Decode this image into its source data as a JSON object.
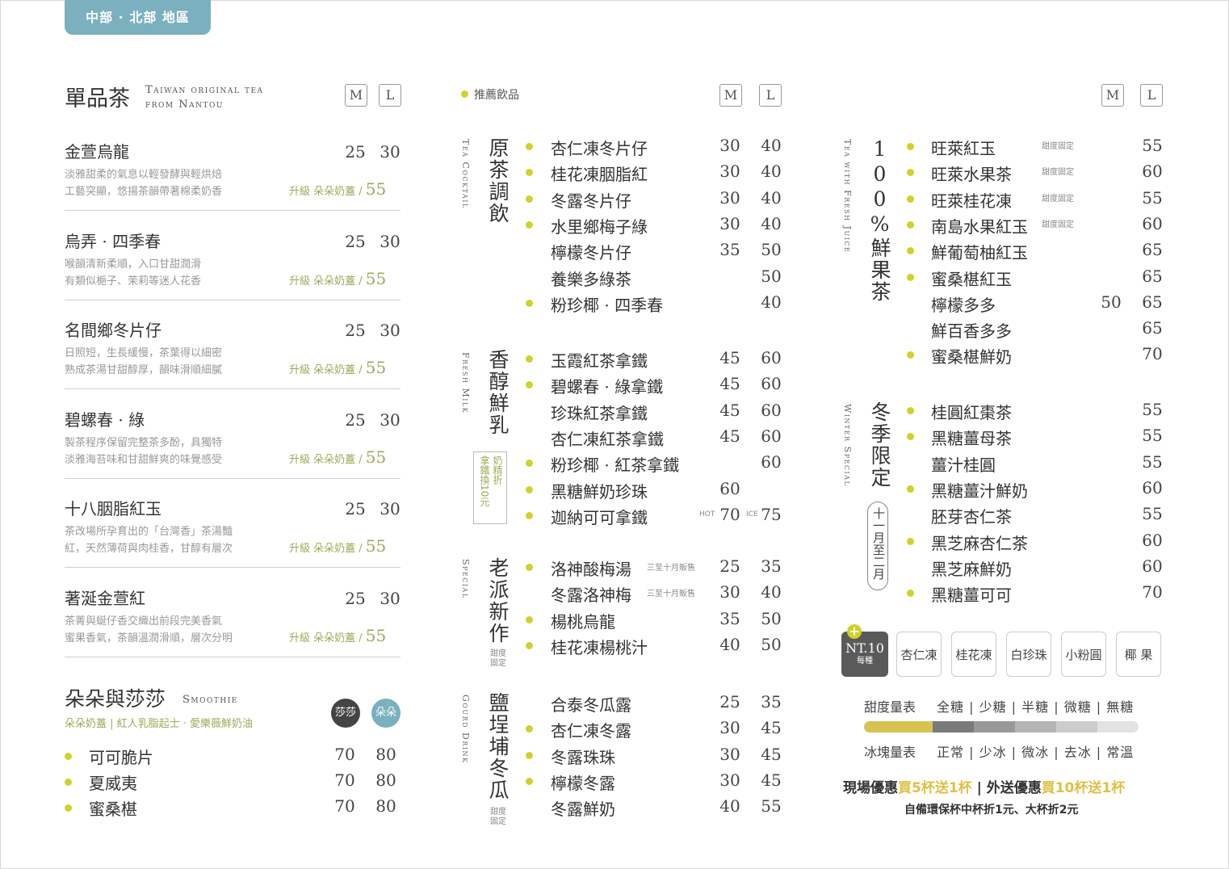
{
  "region": "中部 · 北部 地區",
  "size_m": "M",
  "size_l": "L",
  "single_tea": {
    "title": "單品茶",
    "en1": "Taiwan original tea",
    "en2": "from Nantou",
    "upgrade_label": "升級 朵朵奶蓋 / ",
    "upgrade_price": "55",
    "items": [
      {
        "name": "金萱烏龍",
        "m": "25",
        "l": "30",
        "d1": "淡雅甜柔的氣息以輕發酵與輕烘焙",
        "d2": "工藝突顯，悠揚茶韻帶著棉柔奶香"
      },
      {
        "name": "烏弄 · 四季春",
        "m": "25",
        "l": "30",
        "d1": "喉韻清新柔順，入口甘甜潤滑",
        "d2": "有類似梔子、茉莉等迷人花香"
      },
      {
        "name": "名間鄉冬片仔",
        "m": "25",
        "l": "30",
        "d1": "日照短，生長緩慢，茶葉得以細密",
        "d2": "熟成茶湯甘甜醇厚，韻味滑順細膩"
      },
      {
        "name": "碧螺春 · 綠",
        "m": "25",
        "l": "30",
        "d1": "製茶程序保留完整茶多酚，具獨特",
        "d2": "淡雅海苔味和甘甜鮮爽的味覺感受"
      },
      {
        "name": "十八胭脂紅玉",
        "m": "25",
        "l": "30",
        "d1": "茶改場所孕育出的「台灣香」茶湯豔",
        "d2": "紅，天然薄荷與肉桂香，甘醇有層次"
      },
      {
        "name": "著涎金萱紅",
        "m": "25",
        "l": "30",
        "d1": "茶菁與蜒仔香交織出前段完美香氣",
        "d2": "蜜果香氣，茶韻溫潤滑順，層次分明"
      }
    ]
  },
  "smoothie": {
    "title": "朵朵與莎莎",
    "en": "Smoothie",
    "sub": "朵朵奶蓋 | 紅人乳脂起士 · 愛樂薇鮮奶油",
    "circle1": "莎莎",
    "circle2": "朵朵",
    "items": [
      {
        "name": "可可脆片",
        "m": "70",
        "l": "80"
      },
      {
        "name": "夏威夷",
        "m": "70",
        "l": "80"
      },
      {
        "name": "蜜桑椹",
        "m": "70",
        "l": "80"
      }
    ]
  },
  "recommended": "推薦飲品",
  "tea_cocktail": {
    "title": "原茶調飲",
    "en": "Tea Cocktail",
    "items": [
      {
        "name": "杏仁凍冬片仔",
        "m": "30",
        "l": "40",
        "dot": true
      },
      {
        "name": "桂花凍胭脂紅",
        "m": "30",
        "l": "40",
        "dot": true
      },
      {
        "name": "冬露冬片仔",
        "m": "30",
        "l": "40",
        "dot": true
      },
      {
        "name": "水里鄉梅子綠",
        "m": "30",
        "l": "40",
        "dot": true
      },
      {
        "name": "檸檬冬片仔",
        "m": "35",
        "l": "50",
        "dot": false
      },
      {
        "name": "養樂多綠茶",
        "m": "",
        "l": "50",
        "dot": false
      },
      {
        "name": "粉珍椰 · 四季春",
        "m": "",
        "l": "40",
        "dot": true
      }
    ]
  },
  "fresh_milk": {
    "title": "香醇鮮乳",
    "en": "Fresh Milk",
    "swap_col1": "奶精折",
    "swap_col2": "拿鐵換10元",
    "hot": "HOT",
    "ice": "ICE",
    "items": [
      {
        "name": "玉霞紅茶拿鐵",
        "m": "45",
        "l": "60",
        "dot": true
      },
      {
        "name": "碧螺春 · 綠拿鐵",
        "m": "45",
        "l": "60",
        "dot": true
      },
      {
        "name": "珍珠紅茶拿鐵",
        "m": "45",
        "l": "60",
        "dot": false
      },
      {
        "name": "杏仁凍紅茶拿鐵",
        "m": "45",
        "l": "60",
        "dot": false
      },
      {
        "name": "粉珍椰 · 紅茶拿鐵",
        "m": "",
        "l": "60",
        "dot": true
      },
      {
        "name": "黑糖鮮奶珍珠",
        "m": "60",
        "l": "",
        "dot": true
      },
      {
        "name": "迦納可可拿鐵",
        "m": "70",
        "l": "75",
        "dot": true
      }
    ]
  },
  "special": {
    "title": "老派新作",
    "en": "Special",
    "sweet": "甜度固定",
    "items": [
      {
        "name": "洛神酸梅湯",
        "note": "三至十月販售",
        "m": "25",
        "l": "35",
        "dot": true
      },
      {
        "name": "冬露洛神梅",
        "note": "三至十月販售",
        "m": "30",
        "l": "40",
        "dot": false
      },
      {
        "name": "楊桃烏龍",
        "note": "",
        "m": "35",
        "l": "50",
        "dot": true
      },
      {
        "name": "桂花凍楊桃汁",
        "note": "",
        "m": "40",
        "l": "50",
        "dot": true
      }
    ]
  },
  "gourd": {
    "title": "鹽埕埔冬瓜",
    "en": "Gourd Drink",
    "sweet": "甜度固定",
    "items": [
      {
        "name": "合泰冬瓜露",
        "m": "25",
        "l": "35",
        "dot": false
      },
      {
        "name": "杏仁凍冬露",
        "m": "30",
        "l": "45",
        "dot": true
      },
      {
        "name": "冬露珠珠",
        "m": "30",
        "l": "45",
        "dot": true
      },
      {
        "name": "檸檬冬露",
        "m": "30",
        "l": "45",
        "dot": true
      },
      {
        "name": "冬露鮮奶",
        "m": "40",
        "l": "55",
        "dot": false
      }
    ]
  },
  "fruit_tea": {
    "title": "100%鮮果茶",
    "en": "Tea with Fresh Juice",
    "fixed": "甜度固定",
    "items": [
      {
        "name": "旺萊紅玉",
        "fixed": true,
        "m": "",
        "l": "55",
        "dot": true
      },
      {
        "name": "旺萊水果茶",
        "fixed": true,
        "m": "",
        "l": "60",
        "dot": true
      },
      {
        "name": "旺萊桂花凍",
        "fixed": true,
        "m": "",
        "l": "55",
        "dot": true
      },
      {
        "name": "南島水果紅玉",
        "fixed": true,
        "m": "",
        "l": "60",
        "dot": true
      },
      {
        "name": "鮮葡萄柚紅玉",
        "fixed": false,
        "m": "",
        "l": "65",
        "dot": true
      },
      {
        "name": "蜜桑椹紅玉",
        "fixed": false,
        "m": "",
        "l": "65",
        "dot": true
      },
      {
        "name": "檸檬多多",
        "fixed": false,
        "m": "50",
        "l": "65",
        "dot": false
      },
      {
        "name": "鮮百香多多",
        "fixed": false,
        "m": "",
        "l": "65",
        "dot": false
      },
      {
        "name": "蜜桑椹鮮奶",
        "fixed": false,
        "m": "",
        "l": "70",
        "dot": true
      }
    ]
  },
  "winter": {
    "title": "冬季限定",
    "en": "Winter Special",
    "range": "十一月至二月",
    "items": [
      {
        "name": "桂圓紅棗茶",
        "l": "55",
        "dot": true
      },
      {
        "name": "黑糖薑母茶",
        "l": "55",
        "dot": true
      },
      {
        "name": "薑汁桂圓",
        "l": "55",
        "dot": false
      },
      {
        "name": "黑糖薑汁鮮奶",
        "l": "60",
        "dot": true
      },
      {
        "name": "胚芽杏仁茶",
        "l": "55",
        "dot": false
      },
      {
        "name": "黑芝麻杏仁茶",
        "l": "60",
        "dot": true
      },
      {
        "name": "黑芝麻鮮奶",
        "l": "60",
        "dot": false
      },
      {
        "name": "黑糖薑可可",
        "l": "70",
        "dot": true
      }
    ]
  },
  "toppings": {
    "plus": "+",
    "price": "NT.10",
    "each": "每種",
    "items": [
      "杏仁凍",
      "桂花凍",
      "白珍珠",
      "小粉圓",
      "椰 果"
    ]
  },
  "scales": {
    "sweet_label": "甜度量表",
    "sweet_opts": "全糖 | 少糖 | 半糖 | 微糖 | 無糖",
    "ice_label": "冰塊量表",
    "ice_opts": "正常 | 少冰 | 微冰 | 去冰 | 常溫",
    "bar_colors": [
      "#d6c452",
      "#7a7a7a",
      "#999999",
      "#b5b5b5",
      "#cccccc",
      "#e3e3e3"
    ]
  },
  "promo": {
    "p1": "現場優惠",
    "p2": "買5杯送1杯",
    "p3": " | 外送優惠",
    "p4": "買10杯送1杯",
    "p5": "自備環保杯中杯折1元、大杯折2元"
  },
  "colors": {
    "accent_tab": "#7bb0bf",
    "dot": "#d1d12a",
    "upgrade": "#9bab58",
    "promo_highlight": "#e0c048"
  }
}
